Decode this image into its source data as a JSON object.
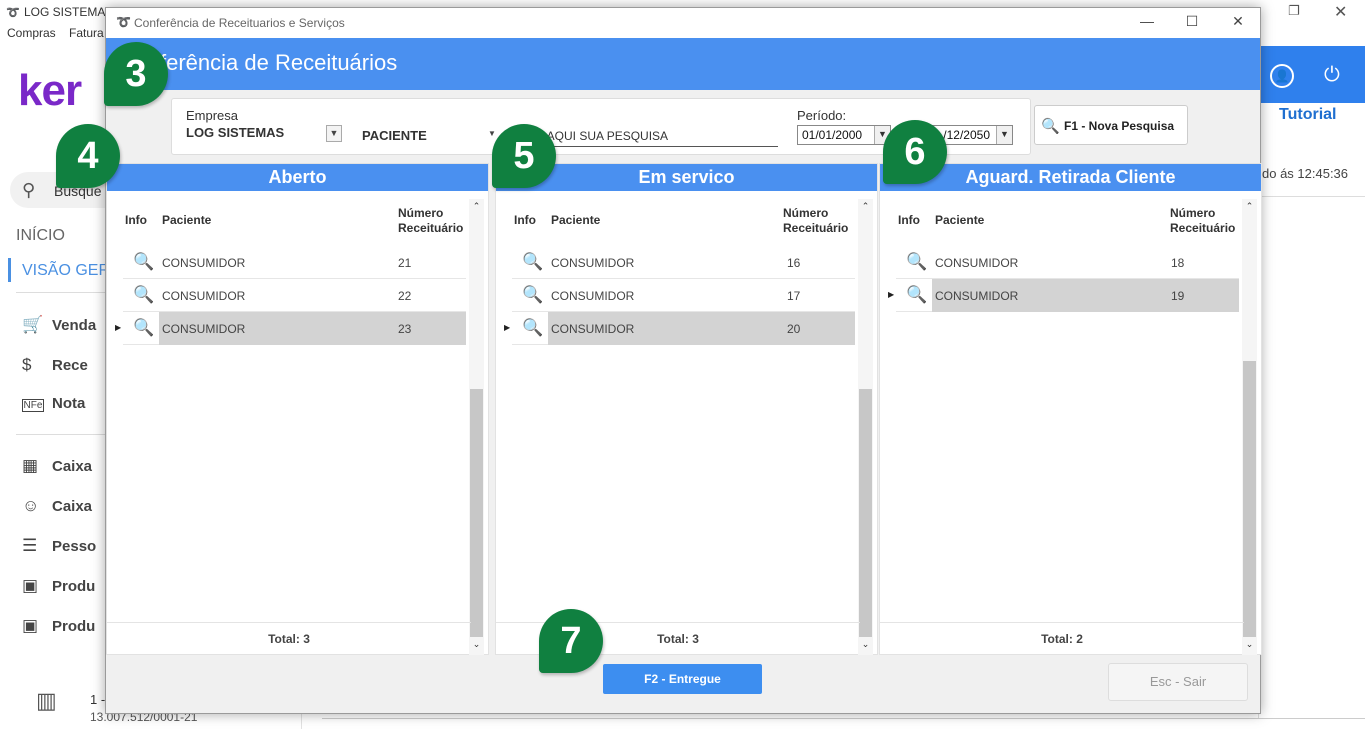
{
  "background_app": {
    "title": "LOG SISTEMAS",
    "menu": [
      "Compras",
      "Fatura"
    ],
    "brand": "ker",
    "search_text": "Busque",
    "inicio": "INÍCIO",
    "visao": "VISÃO GER",
    "nav_items": [
      {
        "label": "Venda",
        "icon": "cart-icon"
      },
      {
        "label": "Rece",
        "icon": "money-hand-icon"
      },
      {
        "label": "Nota",
        "icon": "nfe-icon"
      },
      {
        "label": "Caixa",
        "icon": "cash-register-icon"
      },
      {
        "label": "Caixa",
        "icon": "user-dollar-icon"
      },
      {
        "label": "Pesso",
        "icon": "person-list-icon"
      },
      {
        "label": "Produ",
        "icon": "box-icon"
      },
      {
        "label": "Produ",
        "icon": "box-icon"
      }
    ],
    "footer_line1": "1 -",
    "footer_line2": "13.007.512/0001-21",
    "tutorial": "Tutorial",
    "updated_text": "do ás 12:45:36"
  },
  "dialog": {
    "title": "Conferência de Receituarios e Serviços",
    "heading": "ferência de Receituários",
    "filters": {
      "empresa_label": "Empresa",
      "empresa_value": "LOG SISTEMAS",
      "tipo_value": "PACIENTE",
      "search_value": "E AQUI SUA PESQUISA",
      "periodo_label": "Período:",
      "date_from": "01/01/2000",
      "date_to": "/12/2050"
    },
    "new_search_button": "F1 - Nova Pesquisa",
    "columns": {
      "info": "Info",
      "paciente": "Paciente",
      "numero_l1": "Número",
      "numero_l2": "Receituário"
    },
    "panels": [
      {
        "title": "Aberto",
        "total": "Total: 3",
        "rows": [
          {
            "paciente": "CONSUMIDOR",
            "numero": "21",
            "selected": false
          },
          {
            "paciente": "CONSUMIDOR",
            "numero": "22",
            "selected": false
          },
          {
            "paciente": "CONSUMIDOR",
            "numero": "23",
            "selected": true
          }
        ]
      },
      {
        "title": "Em servico",
        "total": "Total: 3",
        "rows": [
          {
            "paciente": "CONSUMIDOR",
            "numero": "16",
            "selected": false
          },
          {
            "paciente": "CONSUMIDOR",
            "numero": "17",
            "selected": false
          },
          {
            "paciente": "CONSUMIDOR",
            "numero": "20",
            "selected": true
          }
        ]
      },
      {
        "title": "Aguard. Retirada Cliente",
        "total": "Total: 2",
        "rows": [
          {
            "paciente": "CONSUMIDOR",
            "numero": "18",
            "selected": false
          },
          {
            "paciente": "CONSUMIDOR",
            "numero": "19",
            "selected": true
          }
        ]
      }
    ],
    "deliver_button": "F2 - Entregue",
    "exit_button": "Esc - Sair"
  },
  "badges": [
    "3",
    "4",
    "5",
    "6",
    "7"
  ],
  "colors": {
    "header_blue": "#4a90f0",
    "badge_green": "#108040",
    "brand_purple": "#7a28c8"
  }
}
